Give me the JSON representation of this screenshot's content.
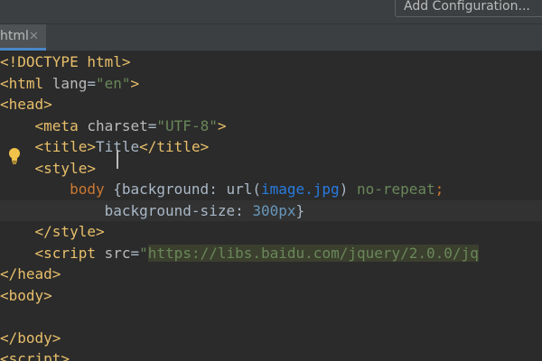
{
  "toolbar": {
    "add_configuration": "Add Configuration..."
  },
  "tab": {
    "label": "html",
    "close": "✕"
  },
  "code": {
    "l1": [
      "<!DOCTYPE html>"
    ],
    "l2": [
      "<html ",
      "lang",
      "=",
      "\"en\"",
      ">"
    ],
    "l3": [
      "<head>"
    ],
    "l4": [
      "    ",
      "<meta ",
      "charset",
      "=",
      "\"UTF-8\"",
      ">"
    ],
    "l5": [
      "    ",
      "<title>",
      "Title",
      "</title>"
    ],
    "l6": [
      "    ",
      "<style>"
    ],
    "l7": [
      "        ",
      "body",
      " {",
      "background",
      ": ",
      "url(",
      "image.jpg",
      ")",
      " no-repeat",
      ";"
    ],
    "l8": [
      "            ",
      "background-size",
      ": ",
      "300px",
      "}"
    ],
    "l9": [
      "    ",
      "</style>"
    ],
    "l10": [
      "    ",
      "<script ",
      "src",
      "=",
      "\"",
      "https://libs.baidu.com/jquery/2.0.0/jq"
    ],
    "l11": [
      "</head>"
    ],
    "l12": [
      "<body>"
    ],
    "l13": [
      ""
    ],
    "l14": [
      "</body>"
    ],
    "l15": [
      "<script>"
    ]
  }
}
